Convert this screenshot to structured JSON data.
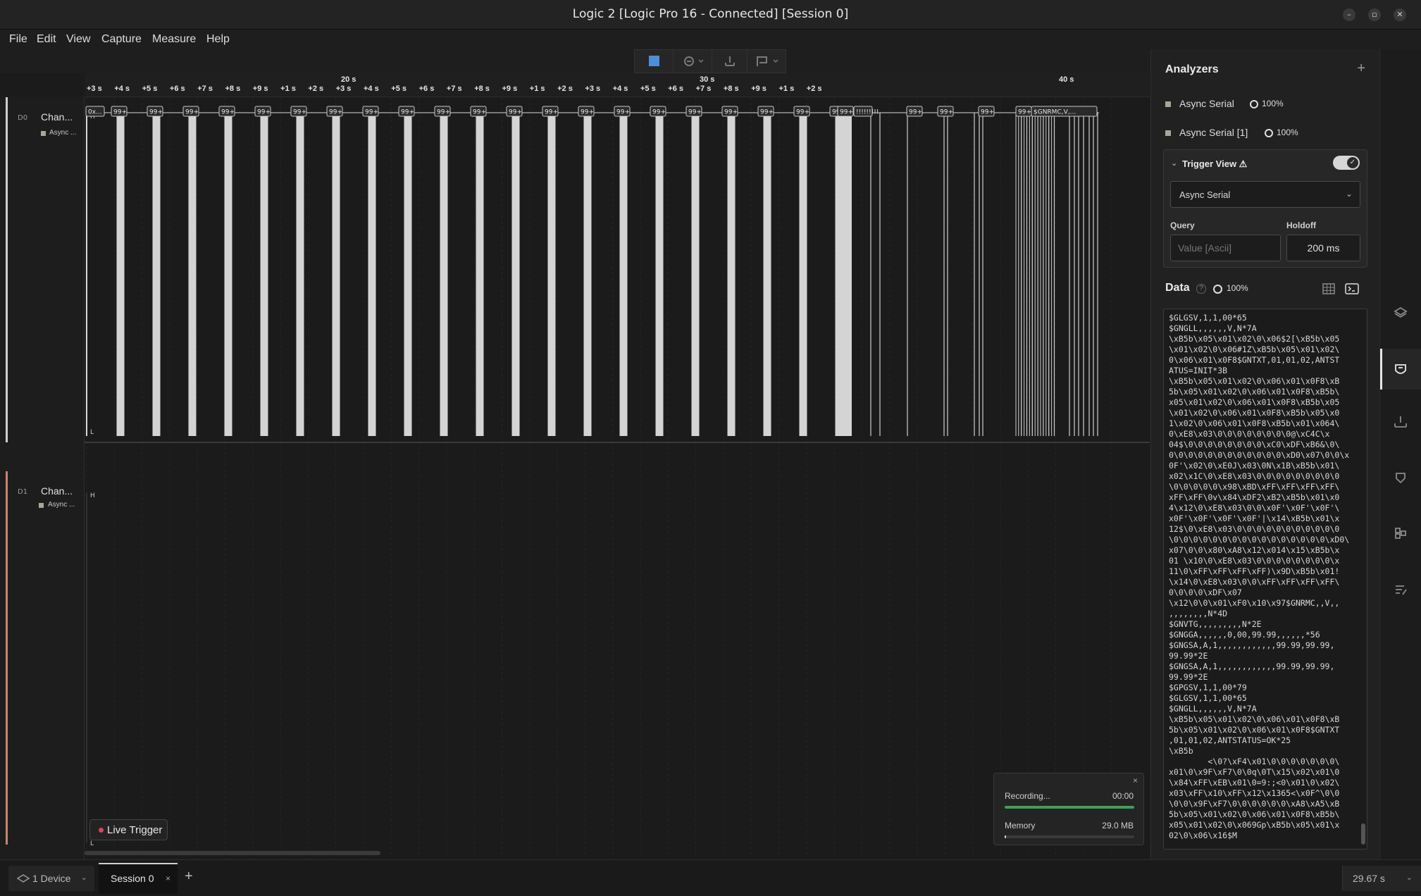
{
  "window": {
    "title": "Logic 2 [Logic Pro 16 - Connected] [Session 0]",
    "controls": [
      "–",
      "▫",
      "✕"
    ]
  },
  "menu": [
    "File",
    "Edit",
    "View",
    "Capture",
    "Measure",
    "Help"
  ],
  "ruler": {
    "major": [
      "20 s",
      "30 s",
      "40 s"
    ],
    "minor": [
      "+3 s",
      "+4 s",
      "+5 s",
      "+6 s",
      "+7 s",
      "+8 s",
      "+9 s",
      "+1 s",
      "+2 s",
      "+3 s",
      "+4 s",
      "+5 s",
      "+6 s",
      "+7 s",
      "+8 s",
      "+9 s",
      "+1 s",
      "+2 s",
      "+3 s",
      "+4 s",
      "+5 s",
      "+6 s",
      "+7 s",
      "+8 s",
      "+9 s",
      "+1 s",
      "+2 s"
    ]
  },
  "channels": [
    {
      "num": "D0",
      "name": "Chan...",
      "analyzer": "Async ..."
    },
    {
      "num": "D1",
      "name": "Chan...",
      "analyzer": "Async ..."
    }
  ],
  "wave": {
    "high_label": "H",
    "low_label": "L",
    "bubble_label": "99+",
    "first_bubble": "0x...",
    "exclaim_label": "!!!!!!!!!",
    "last_bubble": "$GNRMC,V,..."
  },
  "live_trigger": {
    "label": "Live Trigger",
    "color": "#e0405a"
  },
  "recording": {
    "label": "Recording...",
    "time": "00:00",
    "progress": 1.0,
    "memory_label": "Memory",
    "memory_value": "29.0 MB",
    "memory_fraction": 0.01,
    "close": "×"
  },
  "analyzers": {
    "title": "Analyzers",
    "add": "+",
    "items": [
      {
        "name": "Async Serial",
        "pct": "100%"
      },
      {
        "name": "Async Serial [1]",
        "pct": "100%"
      }
    ],
    "trigger_view": {
      "title": "Trigger View ⚠",
      "enabled": true,
      "selected_analyzer": "Async Serial",
      "query_label": "Query",
      "query_placeholder": "Value [Ascii]",
      "holdoff_label": "Holdoff",
      "holdoff_value": "200 ms"
    }
  },
  "data": {
    "title": "Data",
    "pct": "100%",
    "terminal_text": "$GLGSV,1,1,00*65\n$GNGLL,,,,,,V,N*7A\n\\xB5b\\x05\\x01\\x02\\0\\x06$2[\\xB5b\\x05\n\\x01\\x02\\0\\x06#1Z\\xB5b\\x05\\x01\\x02\\\n0\\x06\\x01\\x0F8$GNTXT,01,01,02,ANTST\nATUS=INIT*3B\n\\xB5b\\x05\\x01\\x02\\0\\x06\\x01\\x0F8\\xB\n5b\\x05\\x01\\x02\\0\\x06\\x01\\x0F8\\xB5b\\\nx05\\x01\\x02\\0\\x06\\x01\\x0F8\\xB5b\\x05\n\\x01\\x02\\0\\x06\\x01\\x0F8\\xB5b\\x05\\x0\n1\\x02\\0\\x06\\x01\\x0F8\\xB5b\\x01\\x064\\\n0\\xE8\\x03\\0\\0\\0\\0\\0\\0\\0\\0@\\xC4C\\x\n04$\\0\\0\\0\\0\\0\\0\\0\\0\\xC0\\xDF\\xB6&\\0\\\n0\\0\\0\\0\\0\\0\\0\\0\\0\\0\\0\\0\\xD0\\x07\\0\\0\\x\n0F'\\x02\\0\\xE0J\\x03\\0N\\x1B\\xB5b\\x01\\\nx02\\x1C\\0\\xE8\\x03\\0\\0\\0\\0\\0\\0\\0\\0\\0\n\\0\\0\\0\\0\\0\\x98\\xBD\\xFF\\xFF\\xFF\\xFF\\\nxFF\\xFF\\0v\\x84\\xDF2\\xB2\\xB5b\\x01\\x0\n4\\x12\\0\\xE8\\x03\\0\\0\\x0F'\\x0F'\\x0F'\\\nx0F'\\x0F'\\x0F'\\x0F'|\\x14\\xB5b\\x01\\x\n12$\\0\\xE8\\x03\\0\\0\\0\\0\\0\\0\\0\\0\\0\\0\\0\n\\0\\0\\0\\0\\0\\0\\0\\0\\0\\0\\0\\0\\0\\0\\0\\0\\xD0\\\nx07\\0\\0\\x80\\xA8\\x12\\x014\\x15\\xB5b\\x\n01 \\x10\\0\\xE8\\x03\\0\\0\\0\\0\\0\\0\\0\\0\\x\n11\\0\\xFF\\xFF\\xFF\\xFF)\\x9D\\xB5b\\x01!\n\\x14\\0\\xE8\\x03\\0\\0\\xFF\\xFF\\xFF\\xFF\\\n0\\0\\0\\0\\xDF\\x07\n\\x12\\0\\0\\x01\\xF0\\x10\\x97$GNRMC,,V,,\n,,,,,,,,N*4D\n$GNVTG,,,,,,,,,N*2E\n$GNGGA,,,,,,0,00,99.99,,,,,,*56\n$GNGSA,A,1,,,,,,,,,,,,99.99,99.99,\n99.99*2E\n$GNGSA,A,1,,,,,,,,,,,,99.99,99.99,\n99.99*2E\n$GPGSV,1,1,00*79\n$GLGSV,1,1,00*65\n$GNGLL,,,,,,V,N*7A\n\\xB5b\\x05\\x01\\x02\\0\\x06\\x01\\x0F8\\xB\n5b\\x05\\x01\\x02\\0\\x06\\x01\\x0F8$GNTXT\n,01,01,02,ANTSTATUS=OK*25\n\\xB5b\n        <\\0?\\xF4\\x01\\0\\0\\0\\0\\0\\0\\0\\\nx01\\0\\x9F\\xF7\\0\\0q\\0T\\x15\\x02\\x01\\0\n\\x84\\xFF\\xEB\\x01\\0=9:;<0\\x01\\0\\x02\\\nx03\\xFF\\x10\\xFF\\x12\\x1365<\\x0F^\\0\\0\n\\0\\0\\x9F\\xF7\\0\\0\\0\\0\\0\\0\\xA8\\xA5\\xB\n5b\\x05\\x01\\x02\\0\\x06\\x01\\x0F8\\xB5b\\\nx05\\x01\\x02\\0\\x069Gp\\xB5b\\x05\\x01\\x\n02\\0\\x06\\x16$M"
  },
  "statusbar": {
    "device": "1 Device",
    "session": "Session 0",
    "session_close": "×",
    "add": "+",
    "duration": "29.67 s"
  }
}
